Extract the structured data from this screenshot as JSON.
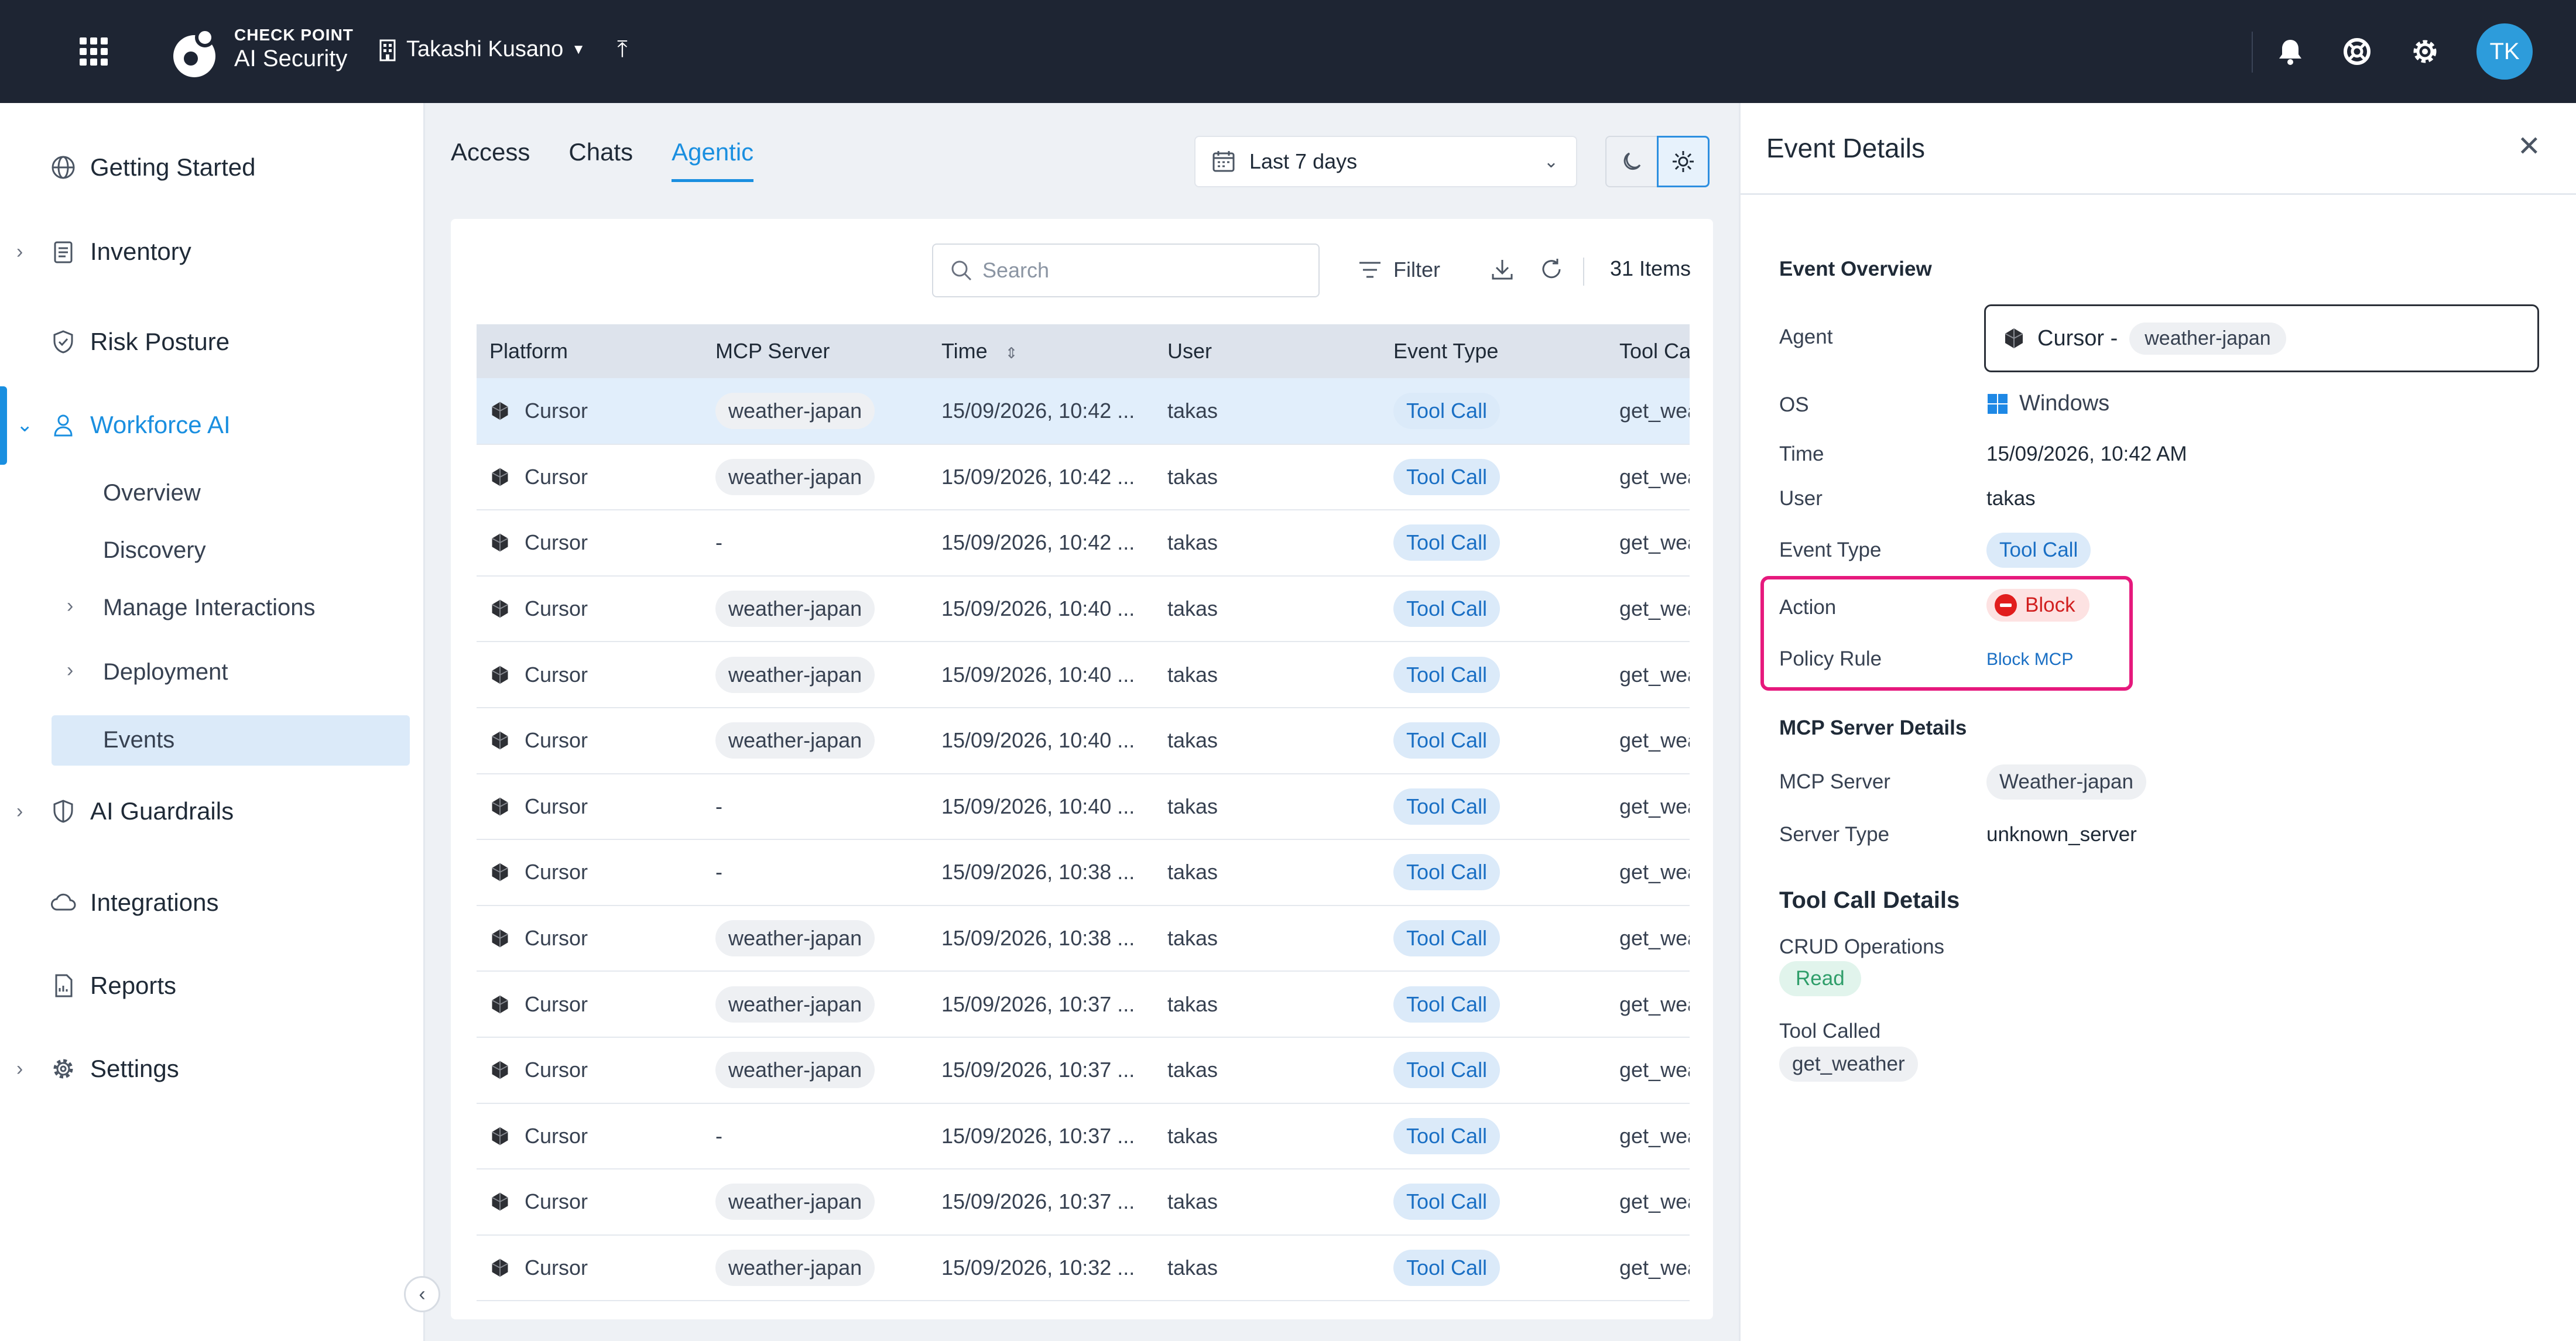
{
  "header": {
    "brand_top": "CHECK POINT",
    "brand_bottom": "AI Security",
    "tenant": "Takashi Kusano",
    "avatar_initials": "TK"
  },
  "sidebar": {
    "items": [
      {
        "label": "Getting Started",
        "icon": "globe-icon"
      },
      {
        "label": "Inventory",
        "icon": "clipboard-icon"
      },
      {
        "label": "Risk Posture",
        "icon": "shield-check-icon"
      },
      {
        "label": "Workforce AI",
        "icon": "user-icon"
      },
      {
        "label": "AI Guardrails",
        "icon": "shield-icon"
      },
      {
        "label": "Integrations",
        "icon": "cloud-icon"
      },
      {
        "label": "Reports",
        "icon": "report-icon"
      },
      {
        "label": "Settings",
        "icon": "gear-icon"
      }
    ],
    "workforce_sub": [
      "Overview",
      "Discovery",
      "Manage Interactions",
      "Deployment",
      "Events"
    ]
  },
  "main": {
    "tabs": [
      "Access",
      "Chats",
      "Agentic"
    ],
    "date_range": "Last 7 days",
    "search_placeholder": "Search",
    "filter_label": "Filter",
    "items_count": "31 Items",
    "columns": [
      "Platform",
      "MCP Server",
      "Time",
      "User",
      "Event Type",
      "Tool Cal"
    ],
    "rows": [
      {
        "platform": "Cursor",
        "mcp": "weather-japan",
        "time": "15/09/2026, 10:42 ...",
        "user": "takas",
        "event": "Tool Call",
        "tool": "get_wea"
      },
      {
        "platform": "Cursor",
        "mcp": "weather-japan",
        "time": "15/09/2026, 10:42 ...",
        "user": "takas",
        "event": "Tool Call",
        "tool": "get_wea"
      },
      {
        "platform": "Cursor",
        "mcp": "-",
        "time": "15/09/2026, 10:42 ...",
        "user": "takas",
        "event": "Tool Call",
        "tool": "get_wea"
      },
      {
        "platform": "Cursor",
        "mcp": "weather-japan",
        "time": "15/09/2026, 10:40 ...",
        "user": "takas",
        "event": "Tool Call",
        "tool": "get_wea"
      },
      {
        "platform": "Cursor",
        "mcp": "weather-japan",
        "time": "15/09/2026, 10:40 ...",
        "user": "takas",
        "event": "Tool Call",
        "tool": "get_wea"
      },
      {
        "platform": "Cursor",
        "mcp": "weather-japan",
        "time": "15/09/2026, 10:40 ...",
        "user": "takas",
        "event": "Tool Call",
        "tool": "get_wea"
      },
      {
        "platform": "Cursor",
        "mcp": "-",
        "time": "15/09/2026, 10:40 ...",
        "user": "takas",
        "event": "Tool Call",
        "tool": "get_wea"
      },
      {
        "platform": "Cursor",
        "mcp": "-",
        "time": "15/09/2026, 10:38 ...",
        "user": "takas",
        "event": "Tool Call",
        "tool": "get_wea"
      },
      {
        "platform": "Cursor",
        "mcp": "weather-japan",
        "time": "15/09/2026, 10:38 ...",
        "user": "takas",
        "event": "Tool Call",
        "tool": "get_wea"
      },
      {
        "platform": "Cursor",
        "mcp": "weather-japan",
        "time": "15/09/2026, 10:37 ...",
        "user": "takas",
        "event": "Tool Call",
        "tool": "get_wea"
      },
      {
        "platform": "Cursor",
        "mcp": "weather-japan",
        "time": "15/09/2026, 10:37 ...",
        "user": "takas",
        "event": "Tool Call",
        "tool": "get_wea"
      },
      {
        "platform": "Cursor",
        "mcp": "-",
        "time": "15/09/2026, 10:37 ...",
        "user": "takas",
        "event": "Tool Call",
        "tool": "get_wea"
      },
      {
        "platform": "Cursor",
        "mcp": "weather-japan",
        "time": "15/09/2026, 10:37 ...",
        "user": "takas",
        "event": "Tool Call",
        "tool": "get_wea"
      },
      {
        "platform": "Cursor",
        "mcp": "weather-japan",
        "time": "15/09/2026, 10:32 ...",
        "user": "takas",
        "event": "Tool Call",
        "tool": "get_wea"
      }
    ]
  },
  "panel": {
    "title": "Event Details",
    "overview_heading": "Event Overview",
    "agent_label": "Agent",
    "agent_value": "Cursor -",
    "agent_mcp": "weather-japan",
    "os_label": "OS",
    "os_value": "Windows",
    "time_label": "Time",
    "time_value": "15/09/2026, 10:42 AM",
    "user_label": "User",
    "user_value": "takas",
    "event_type_label": "Event Type",
    "event_type_value": "Tool Call",
    "action_label": "Action",
    "action_value": "Block",
    "policy_label": "Policy Rule",
    "policy_value": "Block MCP",
    "mcp_heading": "MCP Server Details",
    "mcp_server_label": "MCP Server",
    "mcp_server_value": "Weather-japan",
    "server_type_label": "Server Type",
    "server_type_value": "unknown_server",
    "tool_heading": "Tool Call Details",
    "crud_label": "CRUD Operations",
    "crud_value": "Read",
    "tool_called_label": "Tool Called",
    "tool_called_value": "get_weather"
  },
  "colors": {
    "accent": "#1a8fe0",
    "topbar": "#1e2533",
    "highlight": "#e6197d",
    "block": "#e11d1d"
  }
}
